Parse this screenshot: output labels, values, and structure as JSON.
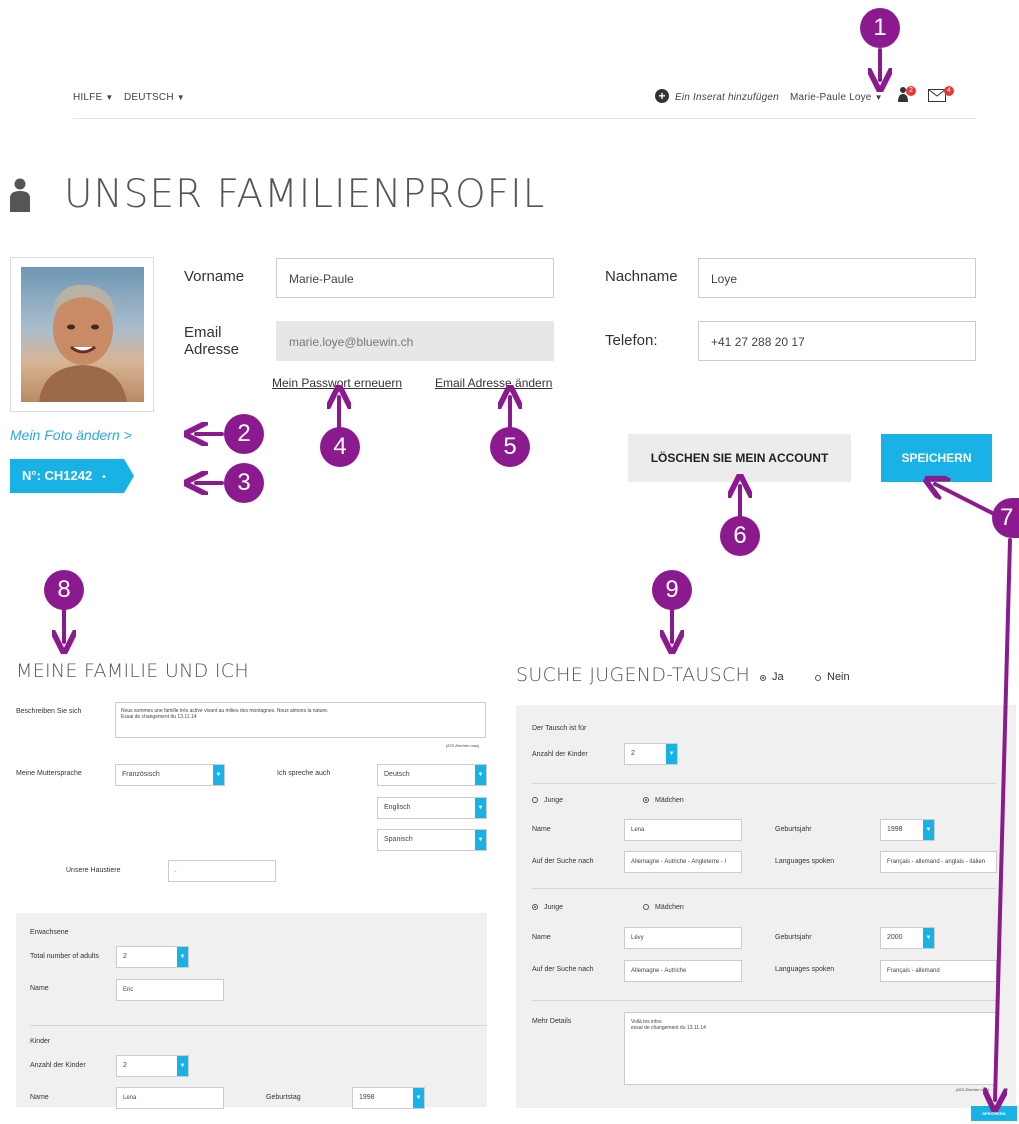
{
  "topnav": {
    "help": "HILFE",
    "language": "DEUTSCH",
    "add_listing": "Ein Inserat hinzufügen",
    "user_name": "Marie-Paule Loye",
    "notif_count": "2",
    "msg_count": "4"
  },
  "page": {
    "title": "UNSER FAMILIENPROFIL"
  },
  "profile": {
    "first_name_label": "Vorname",
    "first_name": "Marie-Paule",
    "last_name_label": "Nachname",
    "last_name": "Loye",
    "email_label_1": "Email",
    "email_label_2": "Adresse",
    "email": "marie.loye@bluewin.ch",
    "phone_label": "Telefon:",
    "phone": "+41 27 288 20 17",
    "renew_password": "Mein Passwort erneuern",
    "change_email": "Email Adresse ändern",
    "change_photo": "Mein Foto ändern >",
    "id_tag": "N°: CH1242",
    "delete_account": "LÖSCHEN SIE MEIN ACCOUNT",
    "save": "SPEICHERN"
  },
  "markers": [
    "1",
    "2",
    "3",
    "4",
    "5",
    "6",
    "7",
    "8",
    "9"
  ],
  "family": {
    "title": "MEINE FAMILIE UND ICH",
    "describe_label": "Beschreiben Sie sich",
    "describe_text_1": "Nous sommes une famille très active vivant au milieu des montagnes. Nous aimons la nature.",
    "describe_text_2": "Essai de changement du 13.11.14",
    "describe_counter": "(876 Zeichen max)",
    "mother_tongue_label": "Meine Muttersprache",
    "mother_tongue": "Französisch",
    "also_speak_label": "Ich spreche auch",
    "also_speak": [
      "Deutsch",
      "Englisch",
      "Spanisch"
    ],
    "pets_label": "Unsere Haustiere",
    "pets": ".",
    "adults_header": "Erwachsene",
    "adults_count_label": "Total number of adults",
    "adults_count": "2",
    "adult_name_label": "Name",
    "adult_name": "Eric",
    "kids_header": "Kinder",
    "kids_count_label": "Anzahl der Kinder",
    "kids_count": "2",
    "kid_name_label": "Name",
    "kid_name": "Lena",
    "birthday_label": "Geburtstag",
    "birthday": "1998"
  },
  "exchange": {
    "title": "SUCHE JUGEND-TAUSCH",
    "yes": "Ja",
    "no": "Nein",
    "for_label": "Der Tausch ist für",
    "kids_count_label": "Anzahl der Kinder",
    "kids_count": "2",
    "boy": "Junge",
    "girl": "Mädchen",
    "name_label": "Name",
    "birth_year_label": "Geburtsjahr",
    "searching_label": "Auf der Suche nach",
    "languages_label": "Languages spoken",
    "child1": {
      "name": "Lena",
      "year": "1998",
      "search": "Allemagne - Autriche - Angleterre - I",
      "languages": "Français - allemand - anglais - italien"
    },
    "child2": {
      "name": "Lévy",
      "year": "2000",
      "search": "Allemagne - Autriche",
      "languages": "Français - allemand"
    },
    "details_label": "Mehr Details",
    "details_1": "Voilà les infos",
    "details_2": "essai de changement du 13.11.14",
    "details_counter": "(933 Zeichen max)",
    "save_small": "SPEICHERN"
  },
  "colors": {
    "accent": "#19b2e6",
    "marker": "#8b1a8f"
  }
}
